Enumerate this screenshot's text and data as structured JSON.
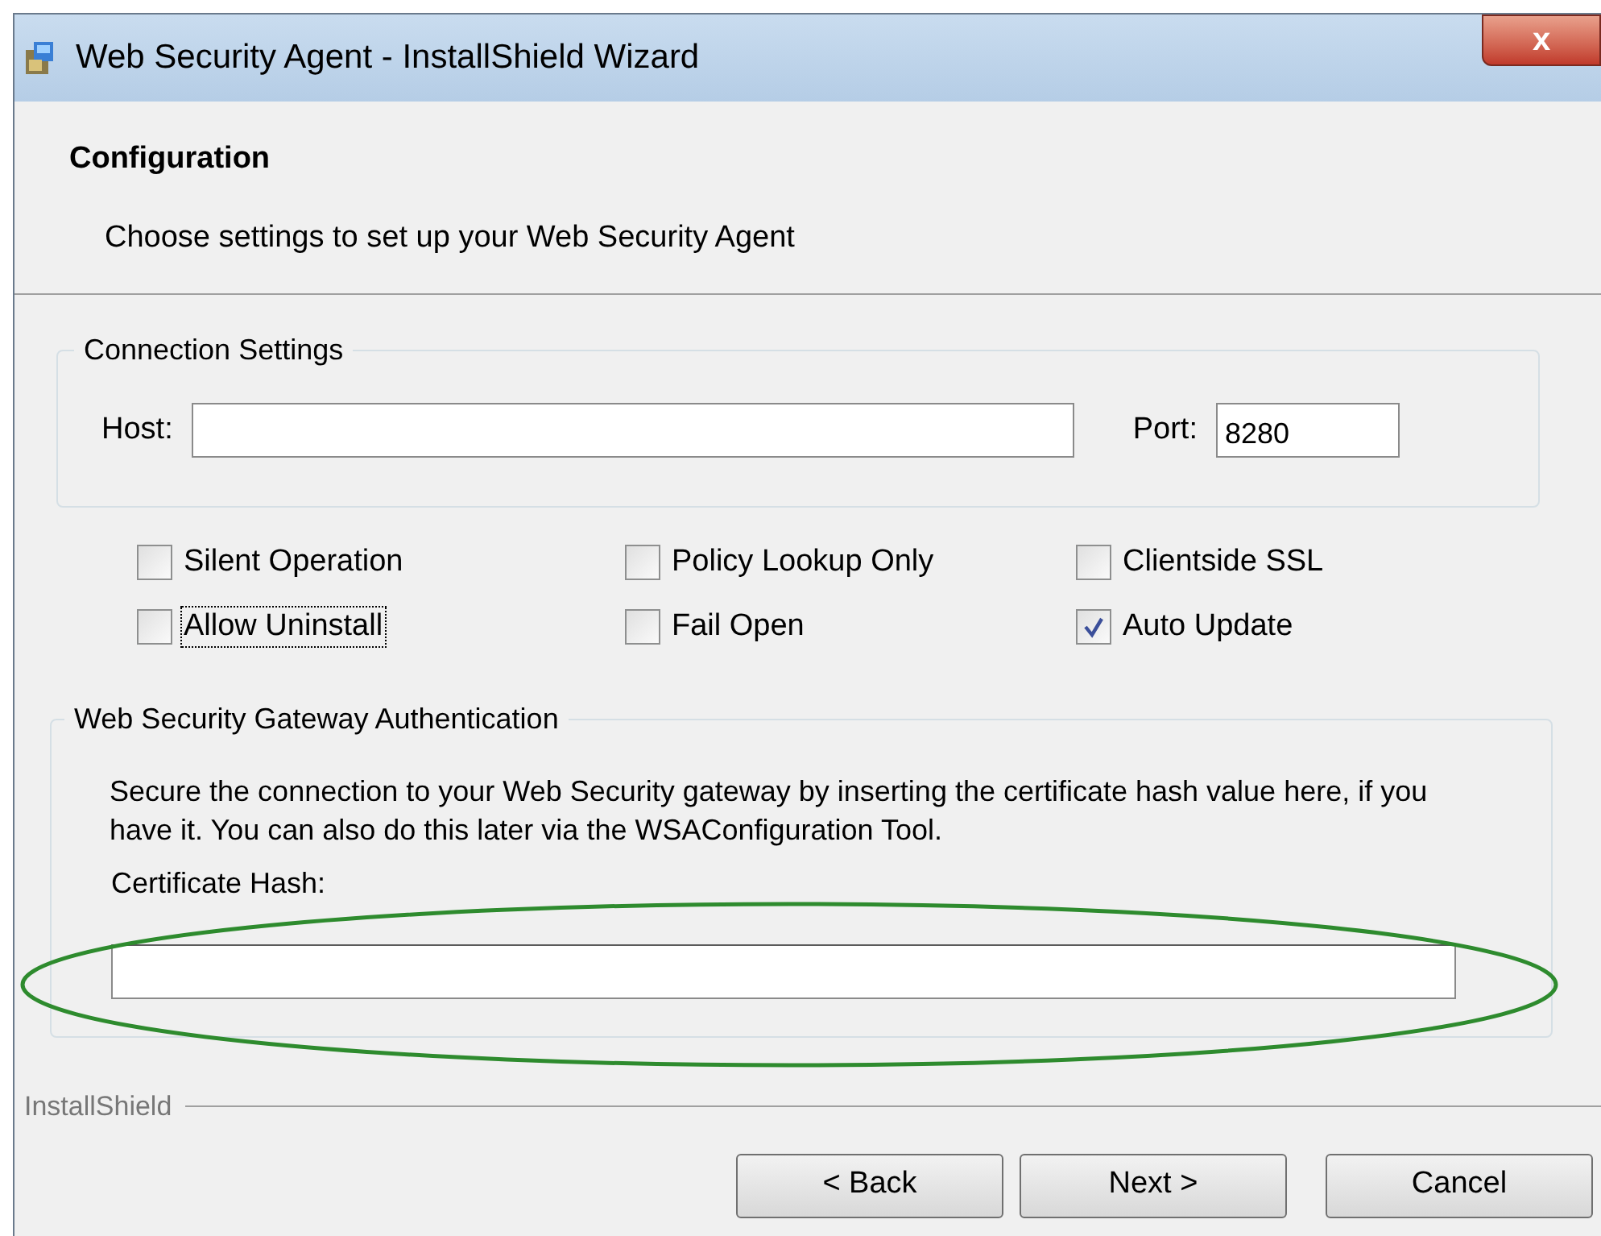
{
  "window": {
    "title": "Web Security Agent - InstallShield Wizard",
    "close": "x"
  },
  "header": {
    "title": "Configuration",
    "subtitle": "Choose settings to set up your Web Security Agent"
  },
  "connection": {
    "legend": "Connection Settings",
    "host_label": "Host:",
    "port_label": "Port:",
    "port_value": "8280"
  },
  "options": [
    {
      "label": "Silent Operation",
      "checked": false,
      "focused": false
    },
    {
      "label": "Policy Lookup Only",
      "checked": false,
      "focused": false
    },
    {
      "label": "Clientside SSL",
      "checked": false,
      "focused": false
    },
    {
      "label": "Allow Uninstall",
      "checked": false,
      "focused": true
    },
    {
      "label": "Fail Open",
      "checked": false,
      "focused": false
    },
    {
      "label": "Auto Update",
      "checked": true,
      "focused": false
    }
  ],
  "authentication": {
    "legend": "Web Security Gateway Authentication",
    "description": "Secure the connection to your Web Security gateway by inserting the certificate hash value here, if you have it. You can also do this later via the WSAConfiguration Tool.",
    "hash_label": "Certificate Hash:"
  },
  "annotations": [
    {
      "kind": "ellipse"
    }
  ],
  "footer": {
    "brand": "InstallShield",
    "buttons": [
      "< Back",
      "Next >",
      "Cancel"
    ]
  }
}
